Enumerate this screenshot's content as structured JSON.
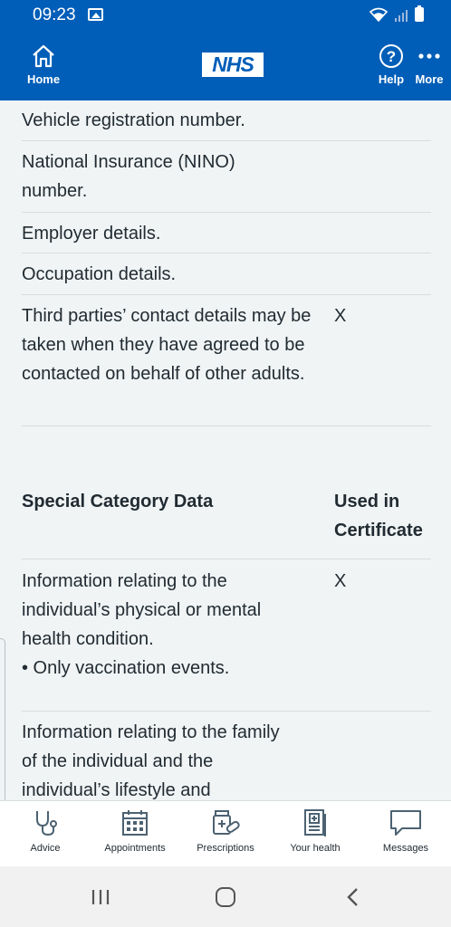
{
  "status_bar": {
    "time": "09:23"
  },
  "header": {
    "home_label": "Home",
    "logo_text": "NHS",
    "help_label": "Help",
    "more_label": "More"
  },
  "content": {
    "rows": [
      {
        "desc": "Vehicle registration number.",
        "used": ""
      },
      {
        "desc": "National Insurance (NINO) number.",
        "used": ""
      },
      {
        "desc": "Employer details.",
        "used": ""
      },
      {
        "desc": "Occupation details.",
        "used": ""
      },
      {
        "desc": "Third parties’ contact details may be taken when they have agreed to be contacted on behalf of other adults.",
        "used": "X"
      }
    ],
    "special_table": {
      "col1_header": "Special Category Data",
      "col2_header": "Used in Certificate",
      "rows": [
        {
          "desc": "Information relating to the individual’s physical or mental health condition.",
          "bullet": "• Only vaccination events.",
          "used": "X"
        },
        {
          "desc": "Information relating to the family of the individual and the individual’s lifestyle and",
          "used": ""
        }
      ]
    }
  },
  "tabs": [
    {
      "label": "Advice",
      "icon": "stethoscope-icon"
    },
    {
      "label": "Appointments",
      "icon": "calendar-icon"
    },
    {
      "label": "Prescriptions",
      "icon": "pills-icon"
    },
    {
      "label": "Your health",
      "icon": "health-record-icon"
    },
    {
      "label": "Messages",
      "icon": "speech-bubble-icon"
    }
  ],
  "colors": {
    "nhs_blue": "#005eb8",
    "text": "#212b32",
    "background": "#f0f4f5",
    "divider": "#d8dde0"
  }
}
